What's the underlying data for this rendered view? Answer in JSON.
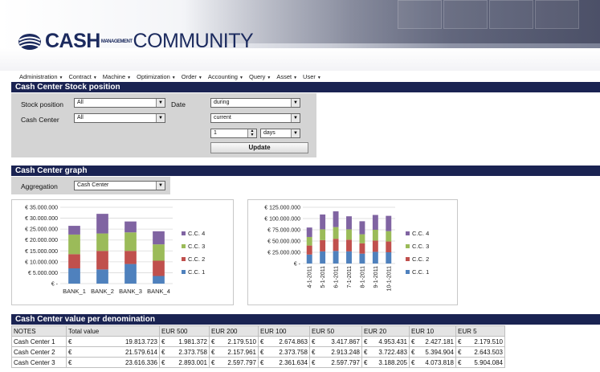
{
  "brand": {
    "name_bold": "CASH",
    "name_tag": "MANAGEMENT",
    "name_rest": "COMMUNITY"
  },
  "menu": [
    {
      "label": "Administration"
    },
    {
      "label": "Contract"
    },
    {
      "label": "Machine"
    },
    {
      "label": "Optimization"
    },
    {
      "label": "Order"
    },
    {
      "label": "Accounting"
    },
    {
      "label": "Query"
    },
    {
      "label": "Asset"
    },
    {
      "label": "User"
    }
  ],
  "stock": {
    "title": "Cash Center Stock position",
    "stock_position_label": "Stock position",
    "stock_position_value": "All",
    "cash_center_label": "Cash Center",
    "cash_center_value": "All",
    "date_label": "Date",
    "date_mode": "during",
    "date_ref": "current",
    "period_value": "1",
    "period_unit": "days",
    "update_label": "Update"
  },
  "graph": {
    "title": "Cash Center graph",
    "aggregation_label": "Aggregation",
    "aggregation_value": "Cash Center"
  },
  "colors": {
    "cc1": "#4f81bd",
    "cc2": "#c0504d",
    "cc3": "#9bbb59",
    "cc4": "#8064a2",
    "navy": "#1a2352"
  },
  "chart_data": [
    {
      "type": "bar",
      "stacked": true,
      "categories": [
        "BANK_1",
        "BANK_2",
        "BANK_3",
        "BANK_4"
      ],
      "series": [
        {
          "name": "C.C. 1",
          "values": [
            7000000,
            6500000,
            9000000,
            3500000
          ]
        },
        {
          "name": "C.C. 2",
          "values": [
            6500000,
            8500000,
            6000000,
            7000000
          ]
        },
        {
          "name": "C.C. 3",
          "values": [
            9000000,
            8000000,
            8500000,
            7500000
          ]
        },
        {
          "name": "C.C. 4",
          "values": [
            4000000,
            9000000,
            5000000,
            6000000
          ]
        }
      ],
      "y_ticks": [
        "€ 35.000.000",
        "€ 30.000.000",
        "€ 25.000.000",
        "€ 20.000.000",
        "€ 15.000.000",
        "€ 10.000.000",
        "€ 5.000.000",
        "€ -"
      ],
      "ylim": [
        0,
        35000000
      ],
      "legend_position": "right",
      "grid": true
    },
    {
      "type": "bar",
      "stacked": true,
      "categories": [
        "4-1-2011",
        "5-1-2011",
        "6-1-2011",
        "7-1-2011",
        "8-1-2011",
        "9-1-2011",
        "10-1-2011"
      ],
      "series": [
        {
          "name": "C.C. 1",
          "values": [
            20000000,
            27000000,
            28000000,
            27000000,
            22000000,
            26000000,
            25000000
          ]
        },
        {
          "name": "C.C. 2",
          "values": [
            20000000,
            25000000,
            27000000,
            26000000,
            23000000,
            25000000,
            24000000
          ]
        },
        {
          "name": "C.C. 3",
          "values": [
            19000000,
            24000000,
            26000000,
            23000000,
            20000000,
            24000000,
            23000000
          ]
        },
        {
          "name": "C.C. 4",
          "values": [
            21000000,
            33000000,
            35000000,
            29000000,
            29000000,
            33000000,
            34000000
          ]
        }
      ],
      "y_ticks": [
        "€ 125.000.000",
        "€ 100.000.000",
        "€ 75.000.000",
        "€ 50.000.000",
        "€ 25.000.000",
        "€ -"
      ],
      "ylim": [
        0,
        125000000
      ],
      "legend_position": "right",
      "grid": true
    }
  ],
  "denomination": {
    "title": "Cash Center value per denomination",
    "headers": [
      "NOTES",
      "Total value",
      "EUR 500",
      "EUR 200",
      "EUR 100",
      "EUR 50",
      "EUR 20",
      "EUR 10",
      "EUR 5"
    ],
    "currency": "€",
    "rows": [
      {
        "name": "Cash Center 1",
        "values": [
          "19.813.723",
          "1.981.372",
          "2.179.510",
          "2.674.863",
          "3.417.867",
          "4.953.431",
          "2.427.181",
          "2.179.510"
        ]
      },
      {
        "name": "Cash Center 2",
        "values": [
          "21.579.614",
          "2.373.758",
          "2.157.961",
          "2.373.758",
          "2.913.248",
          "3.722.483",
          "5.394.904",
          "2.643.503"
        ]
      },
      {
        "name": "Cash Center 3",
        "values": [
          "23.616.336",
          "2.893.001",
          "2.597.797",
          "2.361.634",
          "2.597.797",
          "3.188.205",
          "4.073.818",
          "5.904.084"
        ]
      }
    ]
  }
}
